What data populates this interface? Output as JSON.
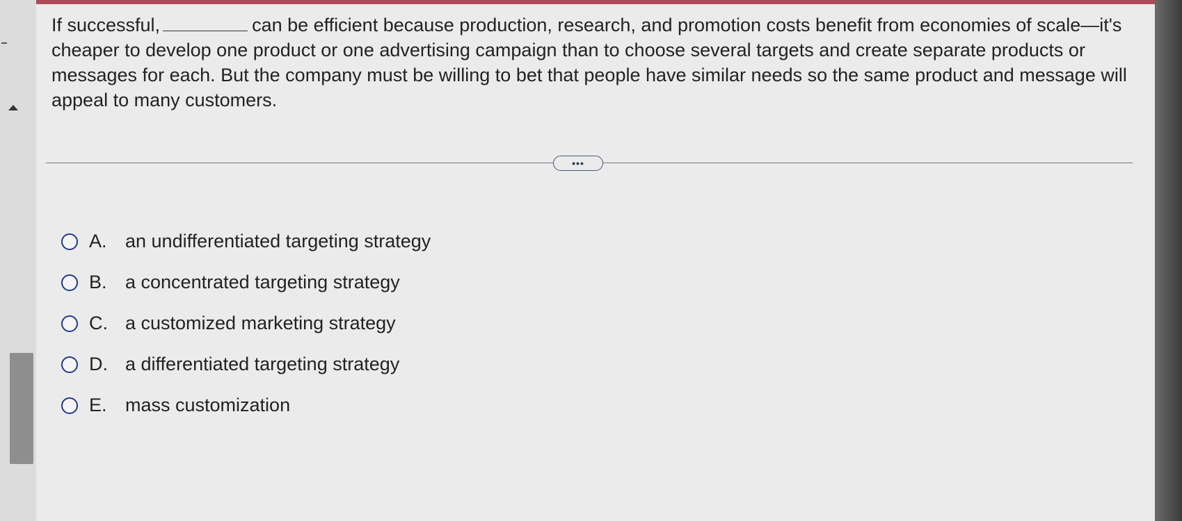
{
  "question": {
    "text_before_blank": "If successful,",
    "text_after_blank": "can be efficient because production, research, and promotion costs benefit from economies of scale—it's cheaper to develop one product or one advertising campaign than to choose several targets and create separate products or messages for each. But the company must be willing to bet that people have similar needs so the same product and message will appeal to many customers."
  },
  "more_button": {
    "label": "•••"
  },
  "options": [
    {
      "letter": "A.",
      "text": "an undifferentiated targeting strategy"
    },
    {
      "letter": "B.",
      "text": "a concentrated targeting strategy"
    },
    {
      "letter": "C.",
      "text": "a customized marketing strategy"
    },
    {
      "letter": "D.",
      "text": "a differentiated targeting strategy"
    },
    {
      "letter": "E.",
      "text": "mass customization"
    }
  ],
  "icons": {
    "collapse": "collapse-arrow-icon",
    "radio": "radio-button-icon"
  },
  "colors": {
    "accent": "#1f3a8a",
    "top_strip": "#b04a5a"
  }
}
